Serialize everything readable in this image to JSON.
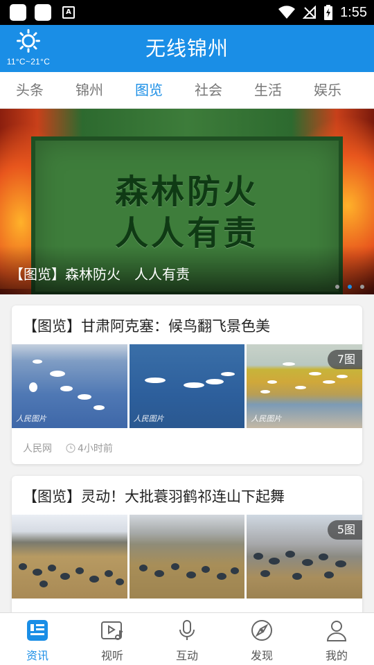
{
  "status_bar": {
    "time": "1:55",
    "icons": [
      "app-square-icon",
      "app-square-icon",
      "font-a-icon",
      "wifi-icon",
      "no-signal-icon",
      "battery-charging-icon"
    ]
  },
  "header": {
    "title": "无线锦州",
    "weather_icon": "sun-icon",
    "temperature": "11°C~21°C",
    "bg_color": "#1a8ee6"
  },
  "tabs": [
    {
      "label": "头条",
      "active": false
    },
    {
      "label": "锦州",
      "active": false
    },
    {
      "label": "图览",
      "active": true
    },
    {
      "label": "社会",
      "active": false
    },
    {
      "label": "生活",
      "active": false
    },
    {
      "label": "娱乐",
      "active": false
    }
  ],
  "banner": {
    "art_line1": "森林防火",
    "art_line2": "人人有责",
    "caption": "【图览】森林防火　人人有责",
    "dots": 3,
    "active_dot": 1
  },
  "cards": [
    {
      "title": "【图览】甘肃阿克塞：候鸟翻飞景色美",
      "photo_count": "7图",
      "source": "人民网",
      "time": "4小时前",
      "watermark": "人民图片"
    },
    {
      "title": "【图览】灵动！大批蓑羽鹤祁连山下起舞",
      "photo_count": "5图",
      "source": "",
      "time": ""
    }
  ],
  "bottom_nav": [
    {
      "label": "资讯",
      "icon": "news-icon",
      "active": true
    },
    {
      "label": "视听",
      "icon": "video-music-icon",
      "active": false
    },
    {
      "label": "互动",
      "icon": "microphone-icon",
      "active": false
    },
    {
      "label": "发现",
      "icon": "compass-icon",
      "active": false
    },
    {
      "label": "我的",
      "icon": "user-icon",
      "active": false
    }
  ],
  "accent_color": "#1a8ee6"
}
